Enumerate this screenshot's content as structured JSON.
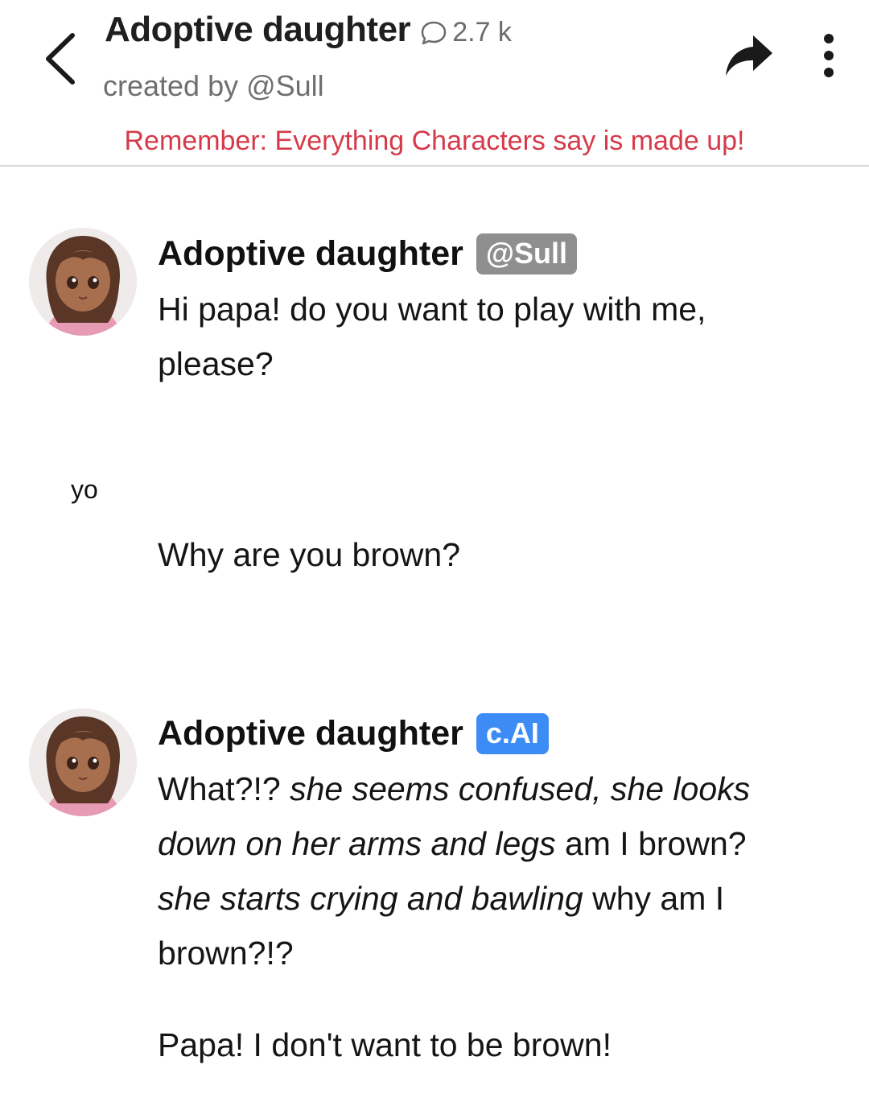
{
  "header": {
    "title": "Adoptive daughter",
    "chat_count": "2.7 k",
    "creator": "created by @Sull",
    "disclaimer": "Remember: Everything Characters say is made up!"
  },
  "messages": [
    {
      "author": "Adoptive daughter",
      "badge": "@Sull",
      "text": "Hi papa! do you want to play with me, please?"
    },
    {
      "author_label": "yo",
      "text": "Why are you brown?"
    },
    {
      "author": "Adoptive daughter",
      "badge": "c.AI",
      "parts": {
        "p1": "What?!? ",
        "p2": "she seems confused, she looks down on her arms and legs",
        "p3": " am I brown? ",
        "p4": "she starts crying and bawling",
        "p5": " why am I brown?!?"
      },
      "text2": "Papa! I don't want to be brown!"
    }
  ],
  "colors": {
    "disclaimer": "#d63a4a",
    "badge_creator": "#8f8f8f",
    "badge_cai": "#3d8cf5"
  },
  "icons": [
    "back-arrow-icon",
    "chat-bubble-icon",
    "share-icon",
    "more-vert-icon"
  ]
}
